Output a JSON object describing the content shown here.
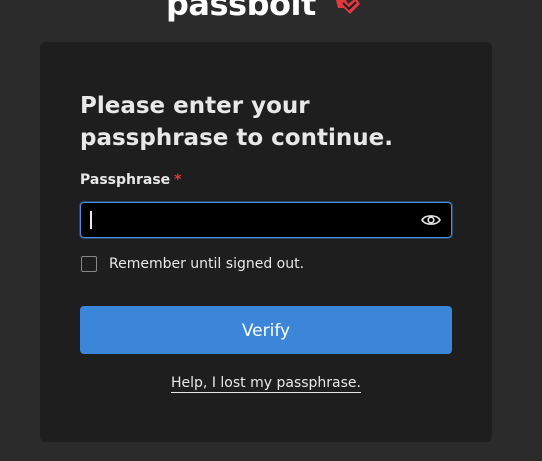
{
  "brand": {
    "logo_text": "passbolt",
    "accent_color": "#e0383e"
  },
  "form": {
    "title": "Please enter your passphrase to continue.",
    "passphrase_label": "Passphrase",
    "required_marker": "*",
    "passphrase_value": "",
    "passphrase_placeholder": "",
    "show_icon": "eye-icon",
    "remember_label": "Remember until signed out.",
    "remember_checked": false,
    "verify_label": "Verify",
    "help_link": "Help, I lost my passphrase."
  },
  "colors": {
    "background": "#2b2b2b",
    "card": "#1e1e1e",
    "primary_button": "#3b86d9",
    "input_focus_border": "#4a90e2"
  }
}
